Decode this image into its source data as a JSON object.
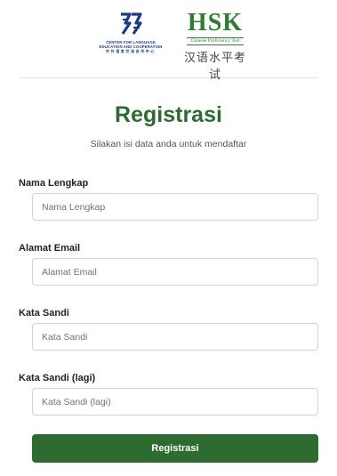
{
  "logos": {
    "cle": {
      "line1": "CENTER FOR LANGUAGE",
      "line2": "EDUCATION AND COOPERATION",
      "line3": "中外语言交流合作中心"
    },
    "hsk": {
      "title": "HSK",
      "subtitle": "Chinese Proficiency Test",
      "chinese": "汉语水平考试"
    },
    "colors": {
      "cle_blue": "#1d3a8a",
      "hsk_green": "#2e7d32"
    }
  },
  "page": {
    "title": "Registrasi",
    "subtitle": "Silakan isi data anda untuk mendaftar"
  },
  "form": {
    "fields": [
      {
        "label": "Nama Lengkap",
        "placeholder": "Nama Lengkap",
        "value": ""
      },
      {
        "label": "Alamat Email",
        "placeholder": "Alamat Email",
        "value": ""
      },
      {
        "label": "Kata Sandi",
        "placeholder": "Kata Sandi",
        "value": ""
      },
      {
        "label": "Kata Sandi (lagi)",
        "placeholder": "Kata Sandi (lagi)",
        "value": ""
      }
    ],
    "submit_label": "Registrasi"
  },
  "colors": {
    "primary": "#2e6b30"
  }
}
